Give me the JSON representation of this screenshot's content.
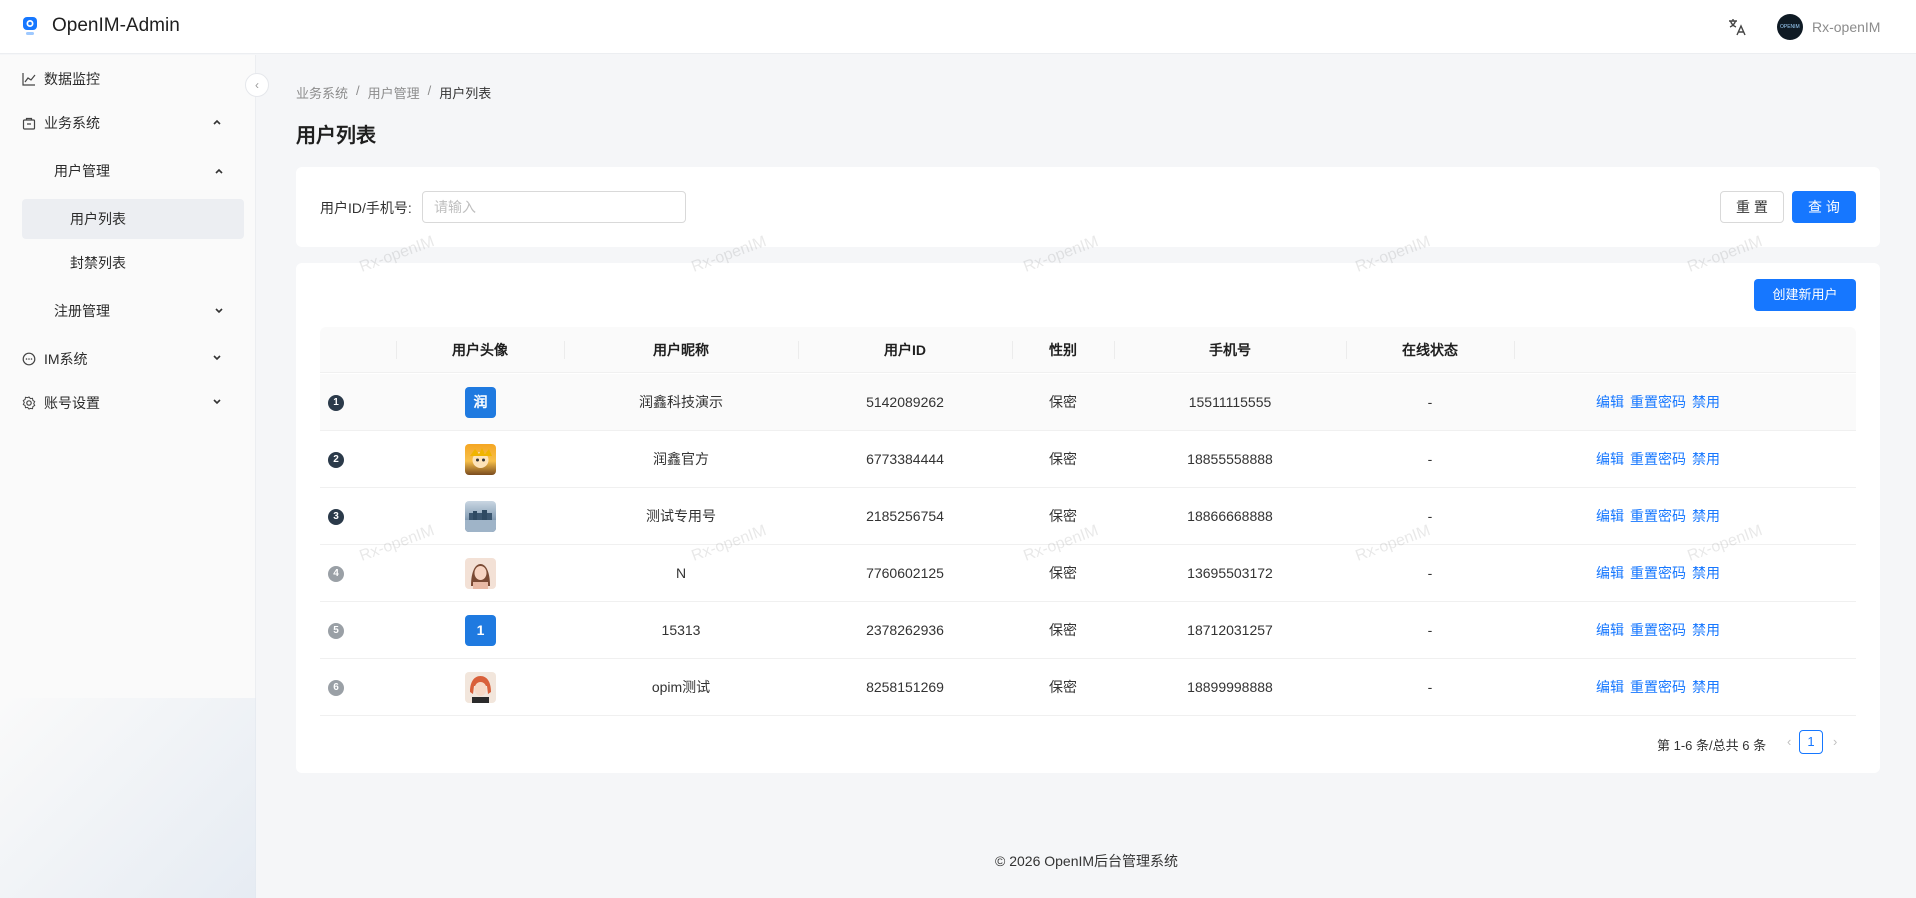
{
  "header": {
    "app_title": "OpenIM-Admin",
    "username": "Rx-openIM"
  },
  "sidebar": {
    "items": [
      {
        "label": "数据监控",
        "icon": "line-chart-icon"
      },
      {
        "label": "业务系统",
        "icon": "shop-icon",
        "expanded": true
      },
      {
        "label": "用户管理",
        "expanded": true
      },
      {
        "label": "用户列表",
        "active": true
      },
      {
        "label": "封禁列表"
      },
      {
        "label": "注册管理"
      },
      {
        "label": "IM系统",
        "icon": "message-icon"
      },
      {
        "label": "账号设置",
        "icon": "gear-icon"
      }
    ]
  },
  "breadcrumb": [
    "业务系统",
    "用户管理",
    "用户列表"
  ],
  "page_title": "用户列表",
  "search": {
    "label": "用户ID/手机号:",
    "placeholder": "请输入",
    "value": "",
    "reset": "重 置",
    "query": "查 询"
  },
  "table": {
    "create_button": "创建新用户",
    "columns": [
      "用户头像",
      "用户昵称",
      "用户ID",
      "性别",
      "手机号",
      "在线状态"
    ],
    "rows": [
      {
        "index": "1",
        "avatar": "润",
        "nickname": "润鑫科技演示",
        "id": "5142089262",
        "gender": "保密",
        "phone": "15511115555",
        "status": "-"
      },
      {
        "index": "2",
        "avatar": "",
        "nickname": "润鑫官方",
        "id": "6773384444",
        "gender": "保密",
        "phone": "18855558888",
        "status": "-"
      },
      {
        "index": "3",
        "avatar": "",
        "nickname": "测试专用号",
        "id": "2185256754",
        "gender": "保密",
        "phone": "18866668888",
        "status": "-"
      },
      {
        "index": "4",
        "avatar": "",
        "nickname": "N",
        "id": "7760602125",
        "gender": "保密",
        "phone": "13695503172",
        "status": "-"
      },
      {
        "index": "5",
        "avatar": "1",
        "nickname": "15313",
        "id": "2378262936",
        "gender": "保密",
        "phone": "18712031257",
        "status": "-"
      },
      {
        "index": "6",
        "avatar": "",
        "nickname": "opim测试",
        "id": "8258151269",
        "gender": "保密",
        "phone": "18899998888",
        "status": "-"
      }
    ],
    "actions": {
      "edit": "编辑",
      "reset_password": "重置密码",
      "disable": "禁用"
    }
  },
  "pagination": {
    "info": "第 1-6 条/总共 6 条",
    "current": "1",
    "prev": "‹",
    "next": "›"
  },
  "watermark": "Rx-openIM",
  "footer": "2026 OpenIM后台管理系统",
  "colors": {
    "primary": "#1677ff",
    "avatar_blue": "#1f7ae0"
  }
}
